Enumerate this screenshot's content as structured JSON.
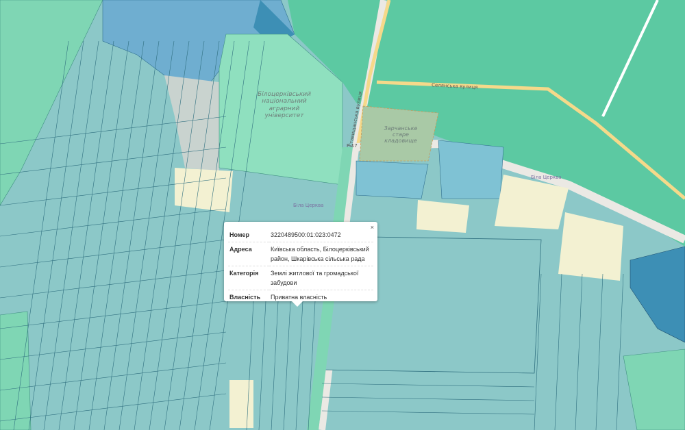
{
  "map": {
    "colors": {
      "field": "#8cc8c8",
      "parcel_green": "#7fd6b4",
      "residential": "#5cc9a2",
      "road": "#ebe9e4",
      "main_road": "#f5d98a",
      "empty_land": "#f3f1d2",
      "cemetery": "#a9c9a6",
      "state_blue": "#3d8fb5"
    },
    "labels": {
      "university": "Білоцерківський національний аграрний університет",
      "cemetery": "Зарчанське старе кладовище",
      "street_vertical": "Ставищанська вулиця",
      "street_selianska": "Селянська вулиця",
      "road_code": "Р-17",
      "town_1": "Біла Церква",
      "town_2": "Біла Церква"
    }
  },
  "popup": {
    "close_label": "×",
    "rows": [
      {
        "key": "Номер",
        "value": "3220489500:01:023:0472"
      },
      {
        "key": "Адреса",
        "value": "Київська область, Білоцерківський район, Шкарівська сільська рада"
      },
      {
        "key": "Категорія",
        "value": "Землі житлової та громадської забудови"
      },
      {
        "key": "Власність",
        "value": "Приватна власність"
      }
    ]
  }
}
